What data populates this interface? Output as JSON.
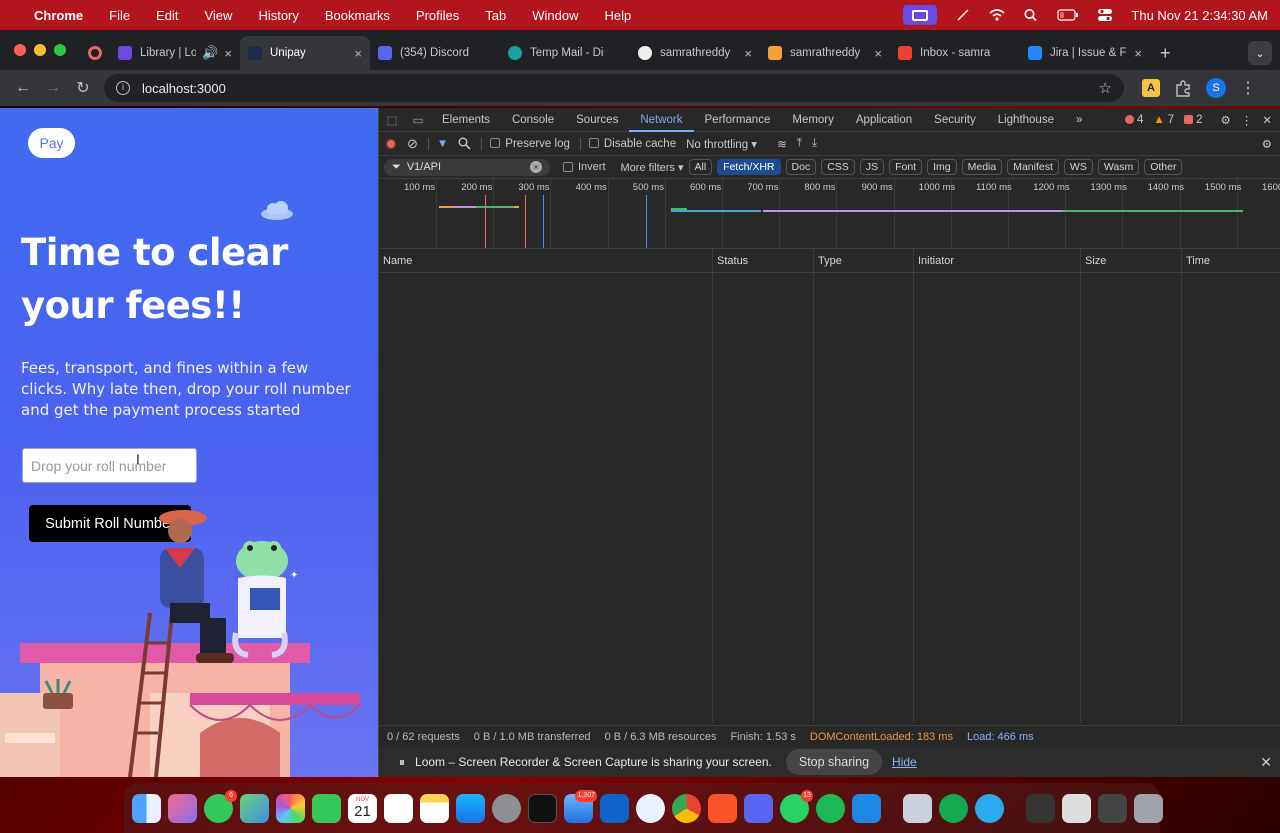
{
  "menubar": {
    "app": "Chrome",
    "items": [
      "File",
      "Edit",
      "View",
      "History",
      "Bookmarks",
      "Profiles",
      "Tab",
      "Window",
      "Help"
    ],
    "clock": "Thu Nov 21  2:34:30 AM"
  },
  "tabs": [
    {
      "title": "",
      "color": "#e46962"
    },
    {
      "title": "Library | Lo",
      "color": "#6d4adf"
    },
    {
      "title": "Unipay",
      "color": "#1b2b4a"
    },
    {
      "title": "(354) Discord",
      "color": "#5865f2"
    },
    {
      "title": "Temp Mail - Di",
      "color": "#1aa39e"
    },
    {
      "title": "samrathreddy",
      "color": "#eeeeee"
    },
    {
      "title": "samrathreddy",
      "color": "#f4a236"
    },
    {
      "title": "Inbox - samra",
      "color": "#ea4335"
    },
    {
      "title": "Jira | Issue & F",
      "color": "#2684ff"
    }
  ],
  "address": {
    "url": "localhost:3000"
  },
  "profile_initial": "S",
  "page": {
    "pay_label": "Pay",
    "title": "Time to clear your fees!!",
    "subtitle": "Fees, transport, and fines within a few clicks. Why late then, drop your roll number and get the payment process started",
    "input_placeholder": "Drop your roll number",
    "submit_label": "Submit Roll Number"
  },
  "devtools": {
    "tabs": [
      "Elements",
      "Console",
      "Sources",
      "Network",
      "Performance",
      "Memory",
      "Application",
      "Security",
      "Lighthouse"
    ],
    "active_tab": "Network",
    "errors": "4",
    "warnings": "7",
    "issues": "2",
    "preserve_log": "Preserve log",
    "disable_cache": "Disable cache",
    "throttling": "No throttling",
    "filter_value": "V1/API",
    "invert": "Invert",
    "more_filters": "More filters",
    "filter_chips": [
      "All",
      "Fetch/XHR",
      "Doc",
      "CSS",
      "JS",
      "Font",
      "Img",
      "Media",
      "Manifest",
      "WS",
      "Wasm",
      "Other"
    ],
    "timeline_ticks": [
      "100 ms",
      "200 ms",
      "300 ms",
      "400 ms",
      "500 ms",
      "600 ms",
      "700 ms",
      "800 ms",
      "900 ms",
      "1000 ms",
      "1100 ms",
      "1200 ms",
      "1300 ms",
      "1400 ms",
      "1500 ms",
      "1600"
    ],
    "columns": [
      "Name",
      "Status",
      "Type",
      "Initiator",
      "Size",
      "Time"
    ],
    "status": {
      "requests": "0 / 62 requests",
      "transferred": "0 B / 1.0 MB transferred",
      "resources": "0 B / 6.3 MB resources",
      "finish": "Finish: 1.53 s",
      "dom": "DOMContentLoaded: 183 ms",
      "load": "Load: 466 ms"
    }
  },
  "loom": {
    "message": "Loom – Screen Recorder & Screen Capture is sharing your screen.",
    "stop": "Stop sharing",
    "hide": "Hide"
  },
  "dock": {
    "calendar_month": "NOV",
    "calendar_day": "21",
    "badges": {
      "messages": "6",
      "mail": "1,307",
      "whatsapp": "13"
    }
  }
}
